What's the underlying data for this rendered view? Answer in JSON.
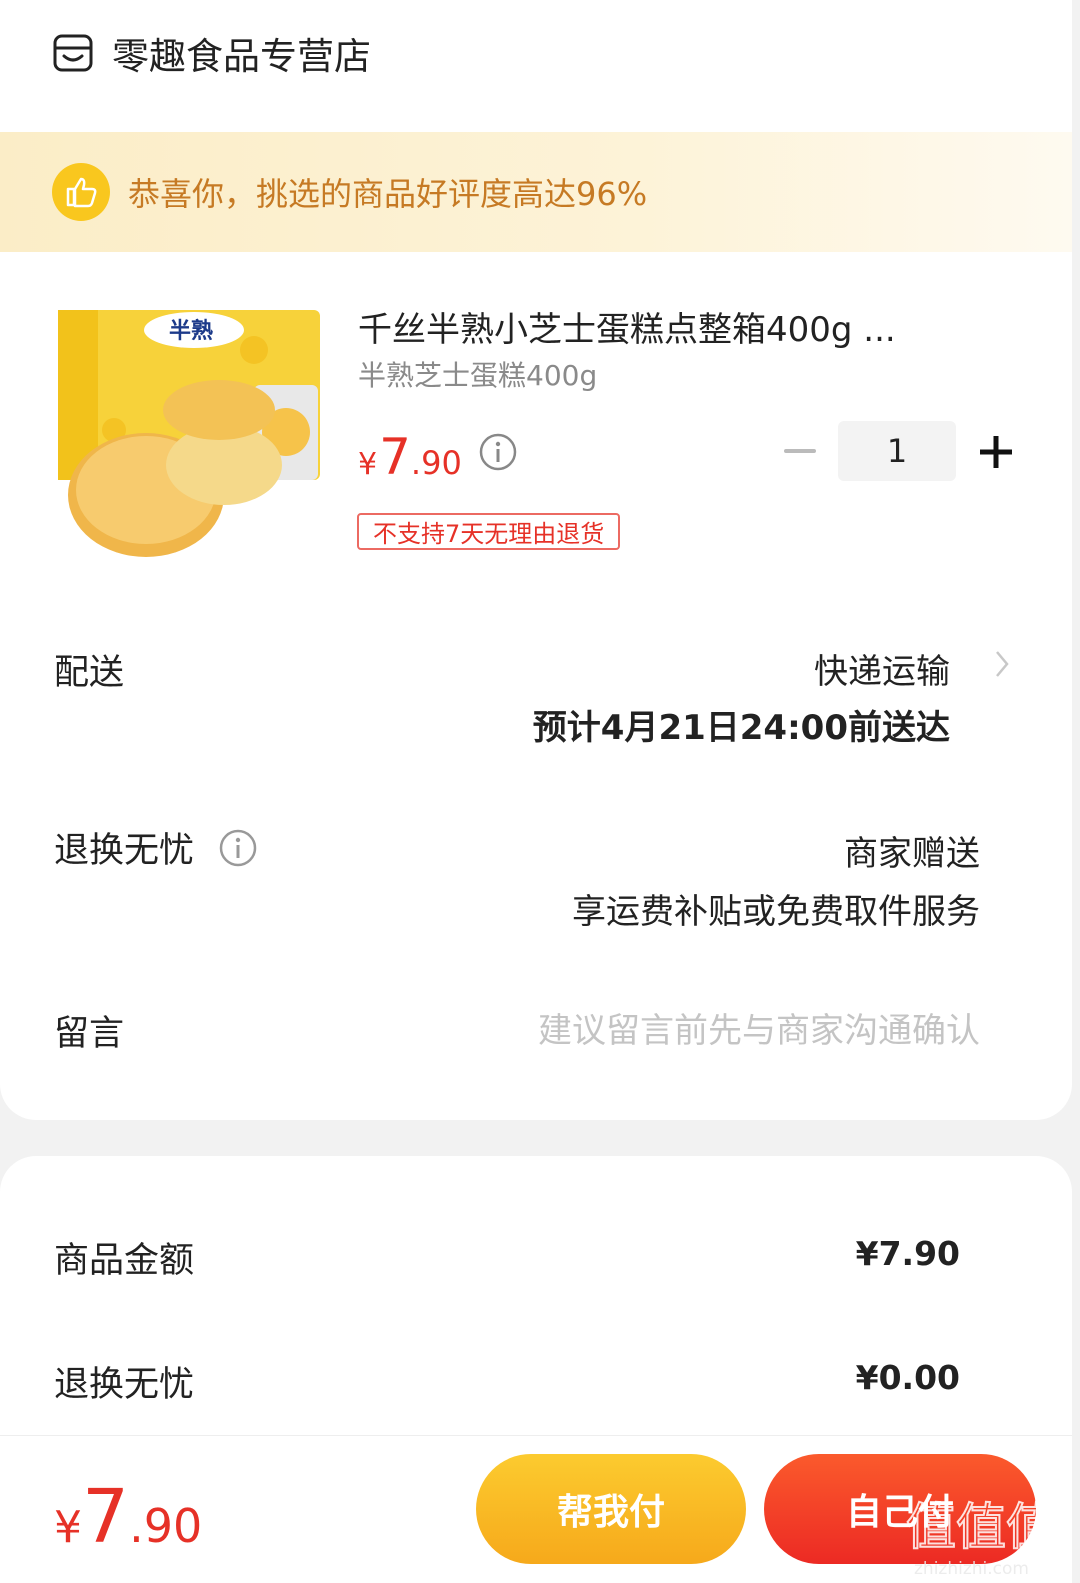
{
  "shop": {
    "name": "零趣食品专营店"
  },
  "banner": {
    "text": "恭喜你，挑选的商品好评度高达96%"
  },
  "product": {
    "title": "千丝半熟小芝士蛋糕点整箱400g ...",
    "spec": "半熟芝士蛋糕400g",
    "price_currency": "¥",
    "price_int": "7",
    "price_dec": ".90",
    "quantity": "1",
    "return_tag": "不支持7天无理由退货"
  },
  "delivery": {
    "label": "配送",
    "method": "快递运输",
    "eta": "预计4月21日24:00前送达"
  },
  "worry_free": {
    "label": "退换无忧",
    "provider": "商家赠送",
    "desc": "享运费补贴或免费取件服务"
  },
  "message": {
    "label": "留言",
    "placeholder": "建议留言前先与商家沟通确认"
  },
  "summary": {
    "goods_label": "商品金额",
    "goods_value": "¥7.90",
    "worry_label": "退换无忧",
    "worry_value": "¥0.00"
  },
  "footer": {
    "total_currency": "¥",
    "total_int": "7",
    "total_dec": ".90",
    "friend_pay": "帮我付",
    "self_pay": "自己付"
  },
  "watermark": {
    "text": "值值值",
    "site": "zhizhizhi.com"
  },
  "colors": {
    "price_red": "#e63127",
    "banner_text": "#c67a24",
    "friend_btn": "#f8b524",
    "self_btn": "#f23d26"
  },
  "icons": [
    "shop-icon",
    "thumbs-up-icon",
    "info-icon",
    "minus-icon",
    "plus-icon",
    "chevron-right-icon"
  ]
}
